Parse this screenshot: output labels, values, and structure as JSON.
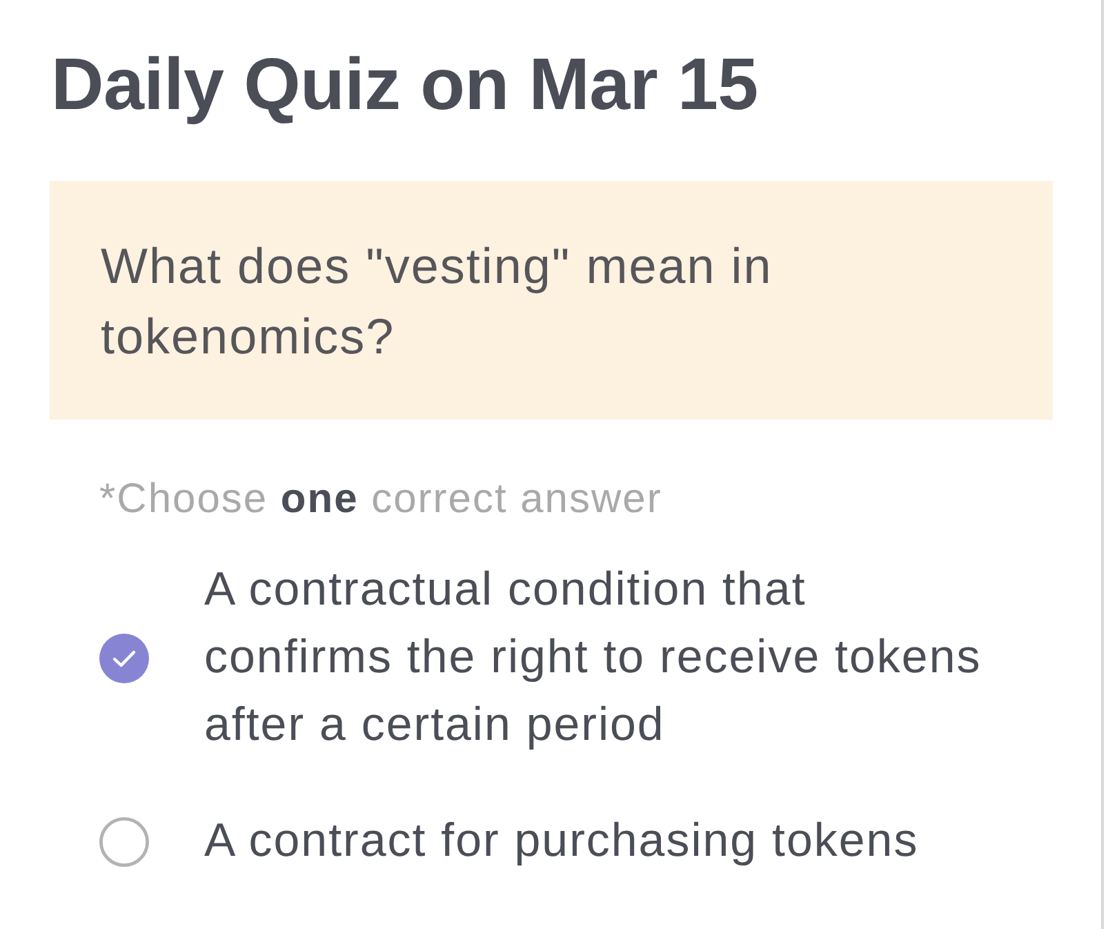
{
  "title": "Daily Quiz on Mar 15",
  "question": "What does \"vesting\" mean in tokenomics?",
  "instruction": "*Choose **one** correct answer",
  "options": [
    {
      "text": "A contractual condition that confirms the right to receive tokens after a certain period",
      "selected": true
    },
    {
      "text": "A contract for purchasing tokens",
      "selected": false
    }
  ]
}
